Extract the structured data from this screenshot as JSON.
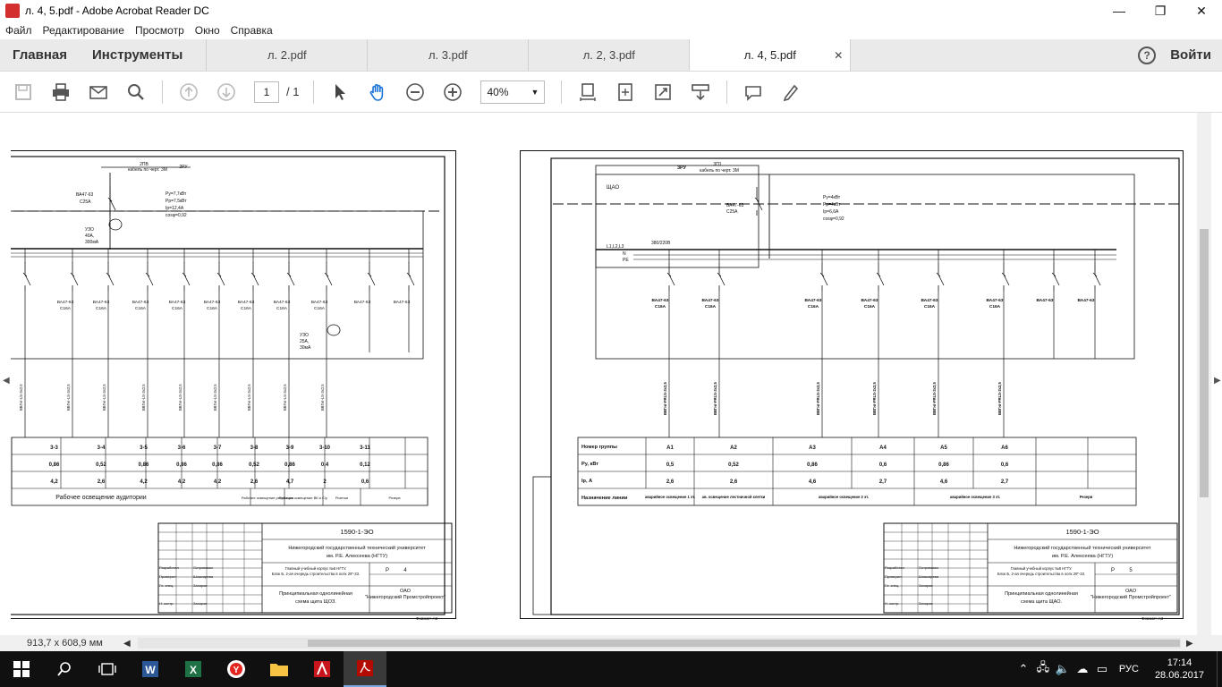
{
  "window": {
    "title": "л. 4, 5.pdf - Adobe Acrobat Reader DC",
    "minimize": "—",
    "maximize": "❐",
    "close": "✕"
  },
  "menu": [
    "Файл",
    "Редактирование",
    "Просмотр",
    "Окно",
    "Справка"
  ],
  "tabs": {
    "home": "Главная",
    "tools": "Инструменты",
    "docs": [
      {
        "label": "л. 2.pdf"
      },
      {
        "label": "л. 3.pdf"
      },
      {
        "label": "л. 2, 3.pdf"
      },
      {
        "label": "л. 4, 5.pdf",
        "active": true
      }
    ],
    "close": "✕",
    "login": "Войти"
  },
  "toolbar": {
    "page_current": "1",
    "page_total": "/ 1",
    "zoom": "40%"
  },
  "status": {
    "dimensions": "913,7 x 608,9 мм"
  },
  "left_sheet": {
    "header_top": "2ПВ",
    "header_cable": "кабель по черт. 3М",
    "header_right": "2РУ",
    "main_breaker": "ВА47-63",
    "main_breaker_rating": "С25А",
    "uzo": [
      "УЗО",
      "40А,",
      "300мА"
    ],
    "params": [
      "Ру=7,7кВт",
      "Рр=7,5кВт",
      "Ip=12,4А",
      "cosφ=0,92"
    ],
    "breakers": [
      {
        "label": "ВА47-63",
        "rating": "С16А"
      },
      {
        "label": "ВА47-63",
        "rating": "С16А"
      },
      {
        "label": "ВА47-63",
        "rating": "С16А"
      },
      {
        "label": "ВА47-63",
        "rating": "С16А"
      },
      {
        "label": "ВА47-63",
        "rating": "С16А"
      },
      {
        "label": "ВА47-63",
        "rating": "С16А"
      },
      {
        "label": "ВА47-63",
        "rating": "С16А"
      },
      {
        "label": "ВА47-63",
        "rating": "С16А"
      },
      {
        "label": "ВА47-63",
        "rating": ""
      },
      {
        "label": "ВА47-63",
        "rating": ""
      }
    ],
    "uzo2": [
      "УЗО",
      "25А,",
      "30мА"
    ],
    "groups": [
      "3-3",
      "3-4",
      "3-5",
      "3-6",
      "3-7",
      "3-8",
      "3-9",
      "3-10",
      "3-11",
      ""
    ],
    "power": [
      "0,86",
      "0,52",
      "0,86",
      "0,86",
      "0,86",
      "0,52",
      "0,86",
      "0,4",
      "0,12",
      ""
    ],
    "current": [
      "4,2",
      "2,6",
      "4,2",
      "4,2",
      "4,2",
      "2,6",
      "4,7",
      "2",
      "0,6",
      ""
    ],
    "purpose_main": "Рабочее освещение аудитории",
    "purpose_extra": [
      "Рабочее освещение рекреации",
      "Рабочее освещение ВК и С/у",
      "Розетки",
      "Резерв"
    ],
    "stamp": {
      "code": "1590-1-ЭО",
      "org": "Нижегородский государственный технический университет им. Р.Е. Алексеева (НГТУ)",
      "object": "Главный учебный корпус №6 НГТУ. Блок Б, 2-ая очередь строительства в осях 29\"-33.",
      "title": "Принципиальная однолинейная схема щита ЩОЗ.",
      "company": "ОАО \"Нижегородский Промстройпроект\"",
      "stage": "Р",
      "sheet": "4",
      "format": "Формат: А3",
      "roles": [
        "Разработал",
        "Проверил",
        "Гл. спец.",
        "Н. контр."
      ],
      "names": [
        "Островская",
        "Шишкарева",
        "Захаров",
        "Захаров"
      ]
    }
  },
  "right_sheet": {
    "header_left": "3РУ",
    "header_top": "3П1",
    "header_cable": "кабель по черт. 3М",
    "panel_name": "ЩАО",
    "main_breaker": "ВА47-63",
    "main_breaker_rating": "С25А",
    "bus_phases": "L1,L2,L3",
    "bus_voltage": "380/220В",
    "params": [
      "Ру=4кВт",
      "Рр=4кВт",
      "Ip=6,6А",
      "cosφ=0,92"
    ],
    "breakers": [
      {
        "label": "ВА47-63",
        "rating": "С16А"
      },
      {
        "label": "ВА47-63",
        "rating": "С16А"
      },
      {
        "label": "ВА47-63",
        "rating": "С16А"
      },
      {
        "label": "ВА47-63",
        "rating": "С16А"
      },
      {
        "label": "ВА47-63",
        "rating": "С16А"
      },
      {
        "label": "ВА47-63",
        "rating": "С16А"
      },
      {
        "label": "ВА47-63",
        "rating": ""
      },
      {
        "label": "ВА47-63",
        "rating": ""
      }
    ],
    "row_labels": [
      "Номер группы",
      "Ру, кВт",
      "Ip, А",
      "Назначение линии"
    ],
    "groups": [
      "А1",
      "А2",
      "А3",
      "А4",
      "А5",
      "А6",
      "",
      ""
    ],
    "power": [
      "0,5",
      "0,52",
      "0,86",
      "0,6",
      "0,86",
      "0,6",
      "",
      ""
    ],
    "current": [
      "2,6",
      "2,6",
      "4,6",
      "2,7",
      "4,6",
      "2,7",
      "",
      ""
    ],
    "purpose": [
      "аварийное освещение 1 эт.",
      "ав. освещение лестничной клетки",
      "аварийное освещение 2 эт.",
      "аварийное освещение 3 эт.",
      "Резерв"
    ],
    "stamp": {
      "code": "1590-1-ЭО",
      "org": "Нижегородский государственный технический университет им. Р.Е. Алексеева (НГТУ)",
      "object": "Главный учебный корпус №6 НГТУ. Блок Б, 2-ая очередь строительства в осях 29\"-33.",
      "title": "Принципиальная однолинейная схема щита ЩАО.",
      "company": "ОАО \"Нижегородский Промстройпроект\"",
      "stage": "Р",
      "sheet": "5",
      "format": "Формат: А3",
      "roles": [
        "Разработал",
        "Проверил",
        "Гл. спец.",
        "Н. контр."
      ],
      "names": [
        "Островская",
        "Шишкарева",
        "Захаров",
        "Захаров"
      ]
    }
  },
  "taskbar": {
    "time": "17:14",
    "date": "28.06.2017",
    "lang": "РУС"
  }
}
